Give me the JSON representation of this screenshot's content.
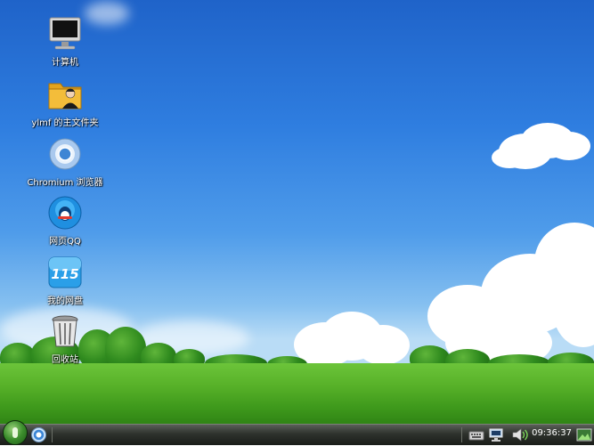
{
  "desktop": {
    "icons": [
      {
        "label": "计算机",
        "icon": "computer-icon"
      },
      {
        "label": "ylmf 的主文件夹",
        "icon": "home-folder-icon"
      },
      {
        "label": "Chromium 浏览器",
        "icon": "chromium-icon"
      },
      {
        "label": "网页QQ",
        "icon": "qq-icon"
      },
      {
        "label": "我的网盘",
        "icon": "115-icon"
      },
      {
        "label": "回收站",
        "icon": "trash-icon"
      }
    ]
  },
  "taskbar": {
    "start_icon": "start-menu-icon",
    "launcher_icon": "chromium-icon",
    "tray_icons": [
      "keyboard-icon",
      "network-icon",
      "volume-icon",
      "show-desktop-icon"
    ],
    "clock": "09:36:37"
  }
}
